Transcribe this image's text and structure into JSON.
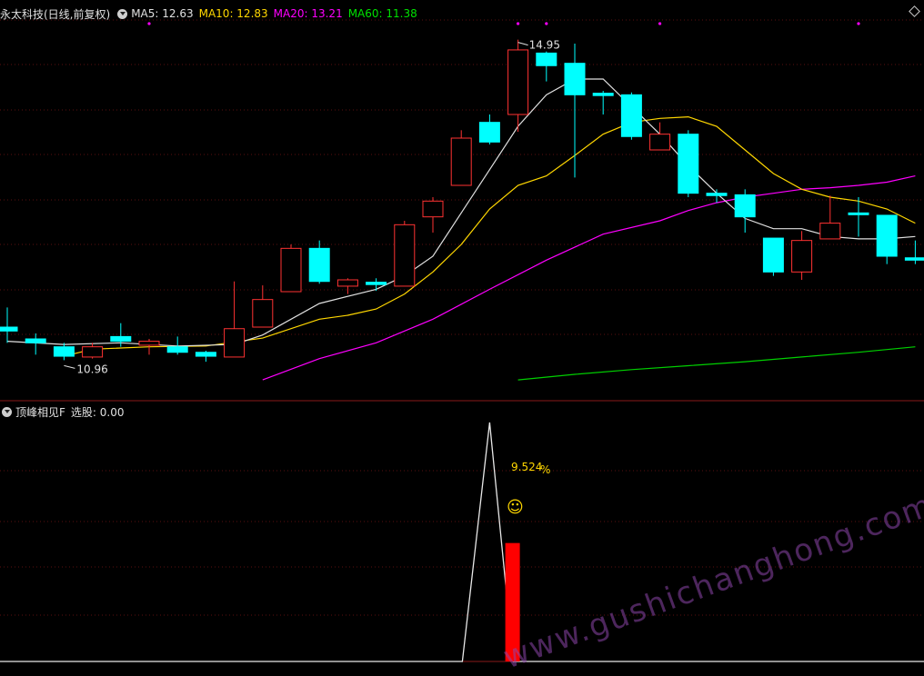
{
  "main_chart": {
    "title": "永太科技(日线,前复权)",
    "ma_labels": [
      {
        "text": "MA5: 12.63",
        "color": "#e0e0e0"
      },
      {
        "text": "MA10: 12.83",
        "color": "#ffd700"
      },
      {
        "text": "MA20: 13.21",
        "color": "#ff00ff"
      },
      {
        "text": "MA60: 11.38",
        "color": "#00e000"
      }
    ],
    "high_label": "14.95",
    "low_label": "10.96",
    "icons": [
      "collapse-icon",
      "diamond-icon"
    ]
  },
  "sub_chart": {
    "title": "顶峰相见F",
    "select_label": "选股: 0.00",
    "percent_label": "9.524",
    "percent_sign": "%",
    "smiley": "☺"
  },
  "watermark": "www.gushichanghong.com",
  "colors": {
    "up": "#ff3232",
    "down": "#00ffff",
    "ma5": "#e0e0e0",
    "ma10": "#ffd700",
    "ma20": "#ff00ff",
    "ma60": "#00d000"
  },
  "chart_data": {
    "type": "candlestick",
    "price_range": [
      10.4,
      15.2
    ],
    "candles": [
      {
        "o": 11.3,
        "h": 11.55,
        "l": 11.1,
        "c": 11.25
      },
      {
        "o": 11.15,
        "h": 11.22,
        "l": 10.95,
        "c": 11.1
      },
      {
        "o": 11.05,
        "h": 11.1,
        "l": 10.88,
        "c": 10.93
      },
      {
        "o": 10.92,
        "h": 11.1,
        "l": 10.9,
        "c": 11.05
      },
      {
        "o": 11.18,
        "h": 11.35,
        "l": 11.05,
        "c": 11.12
      },
      {
        "o": 11.07,
        "h": 11.15,
        "l": 10.95,
        "c": 11.12
      },
      {
        "o": 11.05,
        "h": 11.18,
        "l": 10.95,
        "c": 10.98
      },
      {
        "o": 10.98,
        "h": 11.0,
        "l": 10.86,
        "c": 10.93
      },
      {
        "o": 10.92,
        "h": 11.88,
        "l": 10.92,
        "c": 11.28
      },
      {
        "o": 11.3,
        "h": 11.83,
        "l": 11.3,
        "c": 11.65
      },
      {
        "o": 11.75,
        "h": 12.35,
        "l": 11.75,
        "c": 12.3
      },
      {
        "o": 12.3,
        "h": 12.4,
        "l": 11.85,
        "c": 11.88
      },
      {
        "o": 11.82,
        "h": 11.92,
        "l": 11.72,
        "c": 11.9
      },
      {
        "o": 11.87,
        "h": 11.92,
        "l": 11.76,
        "c": 11.84
      },
      {
        "o": 11.82,
        "h": 12.65,
        "l": 11.82,
        "c": 12.6
      },
      {
        "o": 12.7,
        "h": 12.95,
        "l": 12.5,
        "c": 12.9
      },
      {
        "o": 13.1,
        "h": 13.8,
        "l": 13.1,
        "c": 13.7
      },
      {
        "o": 13.9,
        "h": 14.0,
        "l": 13.62,
        "c": 13.65
      },
      {
        "o": 14.0,
        "h": 14.95,
        "l": 13.78,
        "c": 14.82
      },
      {
        "o": 14.78,
        "h": 14.8,
        "l": 14.42,
        "c": 14.62
      },
      {
        "o": 14.65,
        "h": 14.9,
        "l": 13.2,
        "c": 14.25
      },
      {
        "o": 14.27,
        "h": 14.3,
        "l": 14.0,
        "c": 14.24
      },
      {
        "o": 14.25,
        "h": 14.28,
        "l": 13.68,
        "c": 13.72
      },
      {
        "o": 13.55,
        "h": 13.9,
        "l": 13.55,
        "c": 13.75
      },
      {
        "o": 13.75,
        "h": 13.8,
        "l": 12.95,
        "c": 13.0
      },
      {
        "o": 13.0,
        "h": 13.05,
        "l": 12.88,
        "c": 12.97
      },
      {
        "o": 12.98,
        "h": 13.05,
        "l": 12.5,
        "c": 12.7
      },
      {
        "o": 12.43,
        "h": 12.43,
        "l": 11.95,
        "c": 12.0
      },
      {
        "o": 12.0,
        "h": 12.52,
        "l": 11.9,
        "c": 12.4
      },
      {
        "o": 12.42,
        "h": 12.97,
        "l": 12.42,
        "c": 12.62
      },
      {
        "o": 12.75,
        "h": 12.95,
        "l": 12.45,
        "c": 12.73
      },
      {
        "o": 12.72,
        "h": 12.72,
        "l": 12.1,
        "c": 12.2
      },
      {
        "o": 12.18,
        "h": 12.4,
        "l": 12.1,
        "c": 12.15
      }
    ],
    "ma5": [
      [
        0,
        11.12
      ],
      [
        2,
        11.08
      ],
      [
        4,
        11.1
      ],
      [
        6,
        11.06
      ],
      [
        8,
        11.08
      ],
      [
        9,
        11.2
      ],
      [
        11,
        11.6
      ],
      [
        13,
        11.78
      ],
      [
        14,
        11.95
      ],
      [
        15,
        12.2
      ],
      [
        16,
        12.75
      ],
      [
        17,
        13.3
      ],
      [
        18,
        13.85
      ],
      [
        19,
        14.25
      ],
      [
        20,
        14.45
      ],
      [
        21,
        14.45
      ],
      [
        22,
        14.1
      ],
      [
        23,
        13.75
      ],
      [
        24,
        13.35
      ],
      [
        25,
        13.0
      ],
      [
        26,
        12.68
      ],
      [
        27,
        12.55
      ],
      [
        28,
        12.55
      ],
      [
        29,
        12.45
      ],
      [
        30,
        12.42
      ],
      [
        31,
        12.42
      ],
      [
        32,
        12.45
      ]
    ],
    "ma10": [
      [
        2,
        10.93
      ],
      [
        3,
        11.02
      ],
      [
        5,
        11.05
      ],
      [
        7,
        11.06
      ],
      [
        9,
        11.16
      ],
      [
        11,
        11.4
      ],
      [
        12,
        11.45
      ],
      [
        13,
        11.53
      ],
      [
        14,
        11.72
      ],
      [
        15,
        12.0
      ],
      [
        16,
        12.35
      ],
      [
        17,
        12.8
      ],
      [
        18,
        13.1
      ],
      [
        19,
        13.22
      ],
      [
        20,
        13.48
      ],
      [
        21,
        13.75
      ],
      [
        22,
        13.9
      ],
      [
        23,
        13.95
      ],
      [
        24,
        13.97
      ],
      [
        25,
        13.85
      ],
      [
        26,
        13.55
      ],
      [
        27,
        13.25
      ],
      [
        28,
        13.05
      ],
      [
        29,
        12.95
      ],
      [
        30,
        12.9
      ],
      [
        31,
        12.8
      ],
      [
        32,
        12.62
      ]
    ],
    "ma20": [
      [
        9,
        10.63
      ],
      [
        11,
        10.9
      ],
      [
        13,
        11.1
      ],
      [
        15,
        11.4
      ],
      [
        17,
        11.78
      ],
      [
        19,
        12.15
      ],
      [
        21,
        12.48
      ],
      [
        23,
        12.65
      ],
      [
        24,
        12.78
      ],
      [
        25,
        12.88
      ],
      [
        26,
        12.95
      ],
      [
        27,
        13.0
      ],
      [
        28,
        13.05
      ],
      [
        29,
        13.07
      ],
      [
        30,
        13.1
      ],
      [
        31,
        13.14
      ],
      [
        32,
        13.22
      ]
    ],
    "ma60": [
      [
        18,
        10.63
      ],
      [
        20,
        10.7
      ],
      [
        22,
        10.76
      ],
      [
        24,
        10.81
      ],
      [
        26,
        10.86
      ],
      [
        28,
        10.92
      ],
      [
        30,
        10.98
      ],
      [
        32,
        11.05
      ]
    ],
    "indicator": {
      "peak_index": 17,
      "signal_bar_index": 18,
      "signal_value": 0.59
    }
  }
}
